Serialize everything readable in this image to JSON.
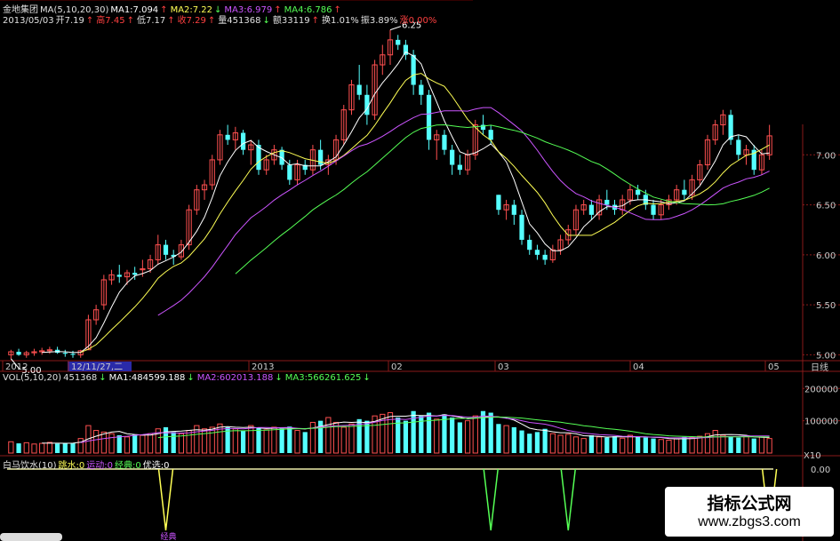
{
  "header": {
    "line1": [
      {
        "text": "金地集团",
        "color": "#e0e0e0"
      },
      {
        "text": "MA(5,10,20,30)",
        "color": "#e0e0e0"
      },
      {
        "text": "MA1:7.094",
        "color": "#ffffff"
      },
      {
        "text": "↑",
        "color": "#ff4040"
      },
      {
        "text": "MA2:7.22",
        "color": "#ffff55"
      },
      {
        "text": "↓",
        "color": "#55ff55"
      },
      {
        "text": "MA3:6.979",
        "color": "#cc55ff"
      },
      {
        "text": "↑",
        "color": "#ff4040"
      },
      {
        "text": "MA4:6.786",
        "color": "#55ff55"
      },
      {
        "text": "↑",
        "color": "#ff4040"
      }
    ],
    "line2": [
      {
        "text": "2013/05/03",
        "color": "#e0e0e0"
      },
      {
        "text": "开7.19",
        "color": "#e0e0e0"
      },
      {
        "text": "↑",
        "color": "#ff4040"
      },
      {
        "text": "高7.45",
        "color": "#ff4040"
      },
      {
        "text": "↑",
        "color": "#ff4040"
      },
      {
        "text": "低7.17",
        "color": "#e0e0e0"
      },
      {
        "text": "↑",
        "color": "#ff4040"
      },
      {
        "text": "收7.29",
        "color": "#ff4040"
      },
      {
        "text": "↑",
        "color": "#ff4040"
      },
      {
        "text": "量451368",
        "color": "#e0e0e0"
      },
      {
        "text": "↓",
        "color": "#55ff55"
      },
      {
        "text": "额33119",
        "color": "#e0e0e0"
      },
      {
        "text": "↑",
        "color": "#ff4040"
      },
      {
        "text": "换1.01%",
        "color": "#e0e0e0"
      },
      {
        "text": "振3.89%",
        "color": "#e0e0e0"
      },
      {
        "text": "涨0.00%",
        "color": "#ff4040"
      }
    ],
    "vol_line": [
      {
        "text": "VOL(5,10,20)",
        "color": "#e0e0e0"
      },
      {
        "text": "451368",
        "color": "#e0e0e0"
      },
      {
        "text": "↓",
        "color": "#55ff55"
      },
      {
        "text": "MA1:484599.188",
        "color": "#ffffff"
      },
      {
        "text": "↓",
        "color": "#55ff55"
      },
      {
        "text": "MA2:602013.188",
        "color": "#cc55ff"
      },
      {
        "text": "↓",
        "color": "#55ff55"
      },
      {
        "text": "MA3:566261.625",
        "color": "#55ff55"
      },
      {
        "text": "↓",
        "color": "#55ff55"
      }
    ],
    "ind_line": [
      {
        "text": "白马饮水(10)",
        "color": "#e0e0e0"
      },
      {
        "text": "跳水:0",
        "color": "#ffff55"
      },
      {
        "text": "运动:0",
        "color": "#cc55ff"
      },
      {
        "text": "经典:0",
        "color": "#55ff55"
      },
      {
        "text": "优选:0",
        "color": "#ffffff"
      }
    ]
  },
  "price_axis": {
    "labels": [
      "7.00",
      "6.50",
      "6.00",
      "5.50",
      "5.00"
    ],
    "values": [
      7.0,
      6.5,
      6.0,
      5.5,
      5.0
    ],
    "period_label": "日线"
  },
  "time_axis": {
    "labels": [
      "2012",
      "12/11/27,二",
      "2013",
      "02",
      "03",
      "04",
      "05"
    ]
  },
  "annotations": {
    "high": "6.25",
    "low": "5.00"
  },
  "vol_axis": {
    "labels": [
      "200000",
      "100000",
      "X10"
    ],
    "values": [
      200000,
      100000
    ]
  },
  "ind_axis": {
    "labels": [
      "0.00",
      "-0.05"
    ],
    "values": [
      0.0,
      -0.05
    ]
  },
  "ind_signal_label": "经典",
  "watermark": {
    "cn": "指标公式网",
    "url": "www.zbgs3.com"
  },
  "colors": {
    "up": "#ff5050",
    "down": "#55ffff",
    "ma1": "#ffffff",
    "ma2": "#ffff55",
    "ma3": "#cc55ff",
    "ma4": "#55ff55",
    "grid": "#8a1a1a"
  },
  "chart_data": {
    "type": "candlestick",
    "title": "金地集团",
    "ylim": [
      4.95,
      7.5
    ],
    "candles": [
      [
        5.0,
        5.05,
        4.96,
        5.03
      ],
      [
        5.03,
        5.06,
        4.99,
        5.0
      ],
      [
        5.0,
        5.04,
        4.97,
        5.02
      ],
      [
        5.02,
        5.06,
        4.99,
        5.03
      ],
      [
        5.03,
        5.07,
        5.0,
        5.04
      ],
      [
        5.04,
        5.08,
        5.01,
        5.05
      ],
      [
        5.05,
        5.08,
        5.01,
        5.02
      ],
      [
        5.02,
        5.05,
        4.98,
        5.01
      ],
      [
        5.01,
        5.04,
        4.97,
        5.0
      ],
      [
        5.0,
        5.05,
        4.97,
        5.04
      ],
      [
        5.05,
        5.4,
        5.05,
        5.35
      ],
      [
        5.35,
        5.5,
        5.3,
        5.45
      ],
      [
        5.5,
        5.8,
        5.45,
        5.75
      ],
      [
        5.75,
        5.85,
        5.7,
        5.8
      ],
      [
        5.8,
        5.9,
        5.72,
        5.78
      ],
      [
        5.78,
        5.85,
        5.7,
        5.82
      ],
      [
        5.82,
        5.88,
        5.75,
        5.8
      ],
      [
        5.85,
        5.95,
        5.78,
        5.86
      ],
      [
        5.86,
        6.0,
        5.82,
        5.95
      ],
      [
        5.95,
        6.2,
        5.9,
        6.1
      ],
      [
        6.1,
        6.15,
        5.95,
        6.0
      ],
      [
        6.0,
        6.05,
        5.9,
        5.98
      ],
      [
        5.98,
        6.15,
        5.95,
        6.1
      ],
      [
        6.1,
        6.5,
        6.05,
        6.45
      ],
      [
        6.45,
        6.7,
        6.4,
        6.65
      ],
      [
        6.65,
        6.75,
        6.55,
        6.7
      ],
      [
        6.7,
        7.0,
        6.65,
        6.95
      ],
      [
        6.95,
        7.25,
        6.9,
        7.2
      ],
      [
        7.2,
        7.3,
        7.1,
        7.15
      ],
      [
        7.15,
        7.28,
        7.05,
        7.22
      ],
      [
        7.22,
        7.25,
        7.0,
        7.05
      ],
      [
        7.05,
        7.15,
        6.9,
        7.1
      ],
      [
        7.1,
        7.15,
        6.8,
        6.85
      ],
      [
        6.85,
        7.0,
        6.8,
        6.95
      ],
      [
        6.95,
        7.1,
        6.9,
        7.05
      ],
      [
        7.05,
        7.08,
        6.85,
        6.9
      ],
      [
        6.9,
        6.95,
        6.7,
        6.75
      ],
      [
        6.75,
        6.95,
        6.7,
        6.9
      ],
      [
        6.9,
        6.95,
        6.8,
        6.85
      ],
      [
        6.85,
        7.1,
        6.8,
        7.05
      ],
      [
        7.05,
        7.15,
        6.85,
        6.9
      ],
      [
        6.9,
        7.0,
        6.8,
        6.95
      ],
      [
        6.95,
        7.2,
        6.9,
        7.15
      ],
      [
        7.15,
        7.5,
        7.1,
        7.45
      ],
      [
        7.45,
        7.75,
        7.4,
        7.7
      ],
      [
        7.7,
        7.9,
        7.55,
        7.6
      ],
      [
        7.6,
        7.7,
        7.3,
        7.4
      ],
      [
        7.4,
        7.95,
        7.35,
        7.9
      ],
      [
        7.9,
        8.1,
        7.8,
        8.0
      ],
      [
        8.0,
        8.25,
        7.9,
        8.15
      ],
      [
        8.15,
        8.2,
        8.05,
        8.1
      ],
      [
        8.1,
        8.15,
        7.95,
        8.0
      ],
      [
        8.0,
        8.05,
        7.6,
        7.7
      ],
      [
        7.7,
        7.75,
        7.5,
        7.6
      ],
      [
        7.6,
        7.65,
        7.05,
        7.15
      ],
      [
        7.15,
        7.25,
        6.95,
        7.2
      ],
      [
        7.2,
        7.25,
        7.0,
        7.05
      ],
      [
        7.05,
        7.1,
        6.8,
        6.9
      ],
      [
        6.9,
        7.0,
        6.8,
        6.85
      ],
      [
        6.85,
        7.05,
        6.8,
        7.0
      ],
      [
        7.0,
        7.35,
        6.95,
        7.3
      ],
      [
        7.3,
        7.4,
        7.2,
        7.25
      ],
      [
        7.25,
        7.3,
        7.1,
        7.15
      ],
      [
        6.6,
        6.6,
        6.4,
        6.45
      ],
      [
        6.45,
        6.55,
        6.35,
        6.5
      ],
      [
        6.5,
        6.55,
        6.3,
        6.4
      ],
      [
        6.4,
        6.45,
        6.1,
        6.15
      ],
      [
        6.15,
        6.2,
        6.0,
        6.05
      ],
      [
        6.05,
        6.1,
        5.95,
        6.0
      ],
      [
        6.0,
        6.05,
        5.9,
        5.95
      ],
      [
        5.95,
        6.1,
        5.92,
        6.05
      ],
      [
        6.05,
        6.2,
        6.0,
        6.15
      ],
      [
        6.15,
        6.3,
        6.1,
        6.25
      ],
      [
        6.25,
        6.5,
        6.2,
        6.45
      ],
      [
        6.45,
        6.55,
        6.4,
        6.5
      ],
      [
        6.5,
        6.55,
        6.35,
        6.4
      ],
      [
        6.4,
        6.6,
        6.35,
        6.55
      ],
      [
        6.55,
        6.65,
        6.45,
        6.5
      ],
      [
        6.5,
        6.55,
        6.4,
        6.45
      ],
      [
        6.45,
        6.6,
        6.4,
        6.55
      ],
      [
        6.55,
        6.7,
        6.5,
        6.65
      ],
      [
        6.65,
        6.7,
        6.55,
        6.6
      ],
      [
        6.6,
        6.65,
        6.45,
        6.5
      ],
      [
        6.5,
        6.55,
        6.35,
        6.4
      ],
      [
        6.4,
        6.55,
        6.35,
        6.5
      ],
      [
        6.5,
        6.6,
        6.45,
        6.55
      ],
      [
        6.55,
        6.7,
        6.5,
        6.65
      ],
      [
        6.65,
        6.75,
        6.55,
        6.6
      ],
      [
        6.6,
        6.8,
        6.55,
        6.75
      ],
      [
        6.75,
        6.95,
        6.7,
        6.9
      ],
      [
        6.9,
        7.2,
        6.85,
        7.15
      ],
      [
        7.15,
        7.35,
        7.1,
        7.3
      ],
      [
        7.3,
        7.45,
        7.2,
        7.4
      ],
      [
        7.4,
        7.45,
        7.1,
        7.15
      ],
      [
        7.15,
        7.2,
        6.95,
        7.0
      ],
      [
        7.0,
        7.1,
        6.9,
        7.05
      ],
      [
        7.05,
        7.1,
        6.8,
        6.85
      ],
      [
        6.85,
        7.05,
        6.8,
        7.0
      ],
      [
        7.0,
        7.3,
        6.95,
        7.19
      ]
    ],
    "volume": [
      35,
      30,
      32,
      28,
      30,
      33,
      29,
      31,
      30,
      45,
      85,
      70,
      65,
      60,
      55,
      50,
      58,
      55,
      60,
      75,
      80,
      65,
      60,
      70,
      85,
      75,
      80,
      90,
      80,
      75,
      70,
      85,
      78,
      72,
      80,
      76,
      82,
      70,
      65,
      95,
      100,
      110,
      95,
      80,
      90,
      105,
      100,
      115,
      120,
      125,
      110,
      100,
      130,
      115,
      125,
      105,
      120,
      110,
      95,
      100,
      115,
      130,
      125,
      90,
      85,
      80,
      70,
      60,
      65,
      75,
      60,
      55,
      58,
      50,
      45,
      55,
      50,
      48,
      52,
      46,
      55,
      50,
      48,
      45,
      42,
      40,
      44,
      50,
      48,
      52,
      60,
      70,
      55,
      50,
      48,
      52,
      45,
      50,
      45
    ],
    "ind_signals": [
      {
        "i": 20,
        "color": "#ffff55"
      },
      {
        "i": 62,
        "color": "#55ff55"
      },
      {
        "i": 72,
        "color": "#55ff55"
      },
      {
        "i": 108,
        "color": "#ffff55"
      }
    ]
  }
}
